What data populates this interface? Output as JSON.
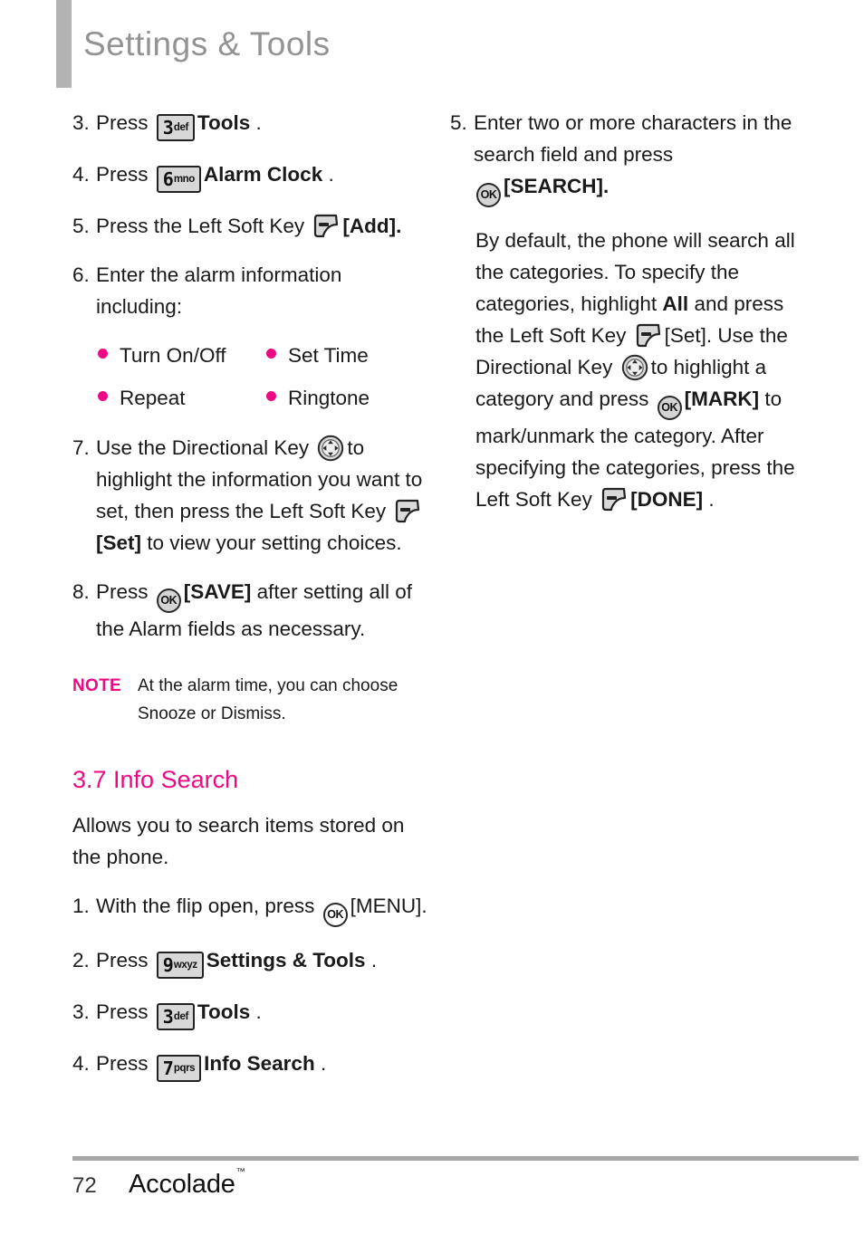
{
  "header": {
    "title": "Settings & Tools"
  },
  "left_column": {
    "steps": [
      {
        "num": "3.",
        "pre": "Press",
        "key": {
          "digit": "3",
          "letters": "def"
        },
        "post": "Tools",
        "post_bold": true,
        "tail": "."
      },
      {
        "num": "4.",
        "pre": "Press",
        "key": {
          "digit": "6",
          "letters": "mno"
        },
        "post": "Alarm Clock",
        "post_bold": true,
        "tail": "."
      },
      {
        "num": "5.",
        "text_a": "Press the Left Soft Key",
        "icon": "left-soft-key",
        "text_b": "[Add].",
        "bold_b": true
      },
      {
        "num": "6.",
        "text": "Enter the alarm information including:"
      },
      {
        "num": "7.",
        "text_a": "Use the Directional Key",
        "icon1": "directional-key",
        "text_b": "to highlight  the information you want to set, then press the Left Soft Key",
        "icon2": "left-soft-key",
        "text_c": "[Set]",
        "text_d": "to view your setting choices."
      },
      {
        "num": "8.",
        "text_a": "Press",
        "icon": "ok-key",
        "text_b": "[SAVE]",
        "text_c": "after setting all of the Alarm fields as necessary."
      }
    ],
    "bullets": [
      [
        "Turn On/Off",
        "Set Time"
      ],
      [
        "Repeat",
        "Ringtone"
      ]
    ],
    "note": {
      "label": "NOTE",
      "text": "At the alarm time, you can choose Snooze or Dismiss."
    },
    "section": {
      "heading": "3.7 Info Search",
      "intro": "Allows you to search items stored on the phone.",
      "steps": [
        {
          "num": "1.",
          "text_a": "With the flip open, press",
          "icon": "ok-key-outline",
          "text_b": "[MENU]."
        },
        {
          "num": "2.",
          "pre": "Press",
          "key": {
            "digit": "9",
            "letters": "wxyz"
          },
          "post": "Settings & Tools",
          "tail": "."
        },
        {
          "num": "3.",
          "pre": "Press",
          "key": {
            "digit": "3",
            "letters": "def"
          },
          "post": "Tools",
          "tail": "."
        },
        {
          "num": "4.",
          "pre": "Press",
          "key": {
            "digit": "7",
            "letters": "pqrs"
          },
          "post": "Info Search",
          "tail": "."
        }
      ]
    }
  },
  "right_column": {
    "step5": {
      "num": "5.",
      "text_a": "Enter two or more characters in the search field and press",
      "icon": "ok-key",
      "text_b": "[SEARCH]."
    },
    "paragraph": {
      "p1": "By default, the phone will search all the categories. To specify the categories, highlight",
      "bold1": "All",
      "p2": "and press the Left Soft Key",
      "icon1": "left-soft-key",
      "p3": "[Set]. Use the Directional Key",
      "icon2": "directional-key",
      "p4": "to highlight a category and press",
      "icon3": "ok-key",
      "bold2": "[MARK]",
      "p5": "to mark/unmark the category. After specifying the categories, press the Left Soft Key",
      "icon4": "left-soft-key",
      "bold3": "[DONE]",
      "p6": "."
    }
  },
  "footer": {
    "page_number": "72",
    "brand": "Accolade",
    "trademark": "™"
  },
  "colors": {
    "accent_magenta": "#EC0A84",
    "header_gray": "#939393",
    "bar_gray": "#b3b3b3",
    "rule_gray": "#a8a8a8"
  }
}
